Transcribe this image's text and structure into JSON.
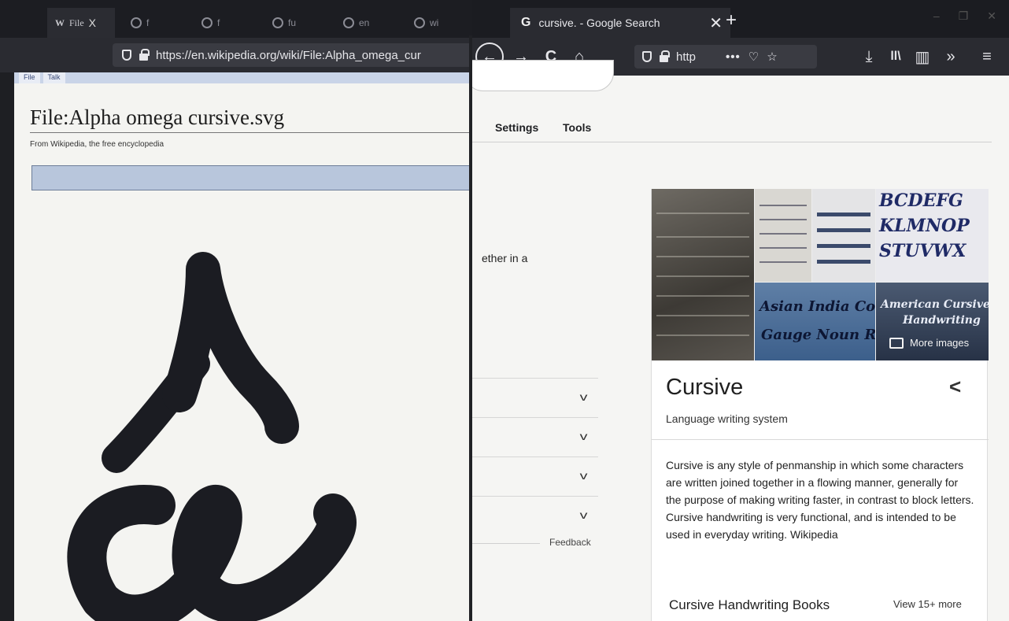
{
  "left_window": {
    "tabs": [
      {
        "favicon": "W",
        "label": "File",
        "close": "X"
      },
      {
        "favicon": "G",
        "label": "f"
      },
      {
        "favicon": "G",
        "label": "f"
      },
      {
        "favicon": "G",
        "label": "fu"
      },
      {
        "favicon": "G",
        "label": "en"
      },
      {
        "favicon": "G",
        "label": "wi"
      }
    ],
    "url": "https://en.wikipedia.org/wiki/File:Alpha_omega_cur",
    "wiki_tabs": [
      "File",
      "Talk"
    ],
    "title": "File:Alpha omega cursive.svg",
    "subtitle": "From Wikipedia, the free encyclopedia"
  },
  "right_window": {
    "tab_title": "cursive. - Google Search",
    "tab_favicon": "G",
    "tab_close": "✕",
    "new_tab": "+",
    "window_controls": [
      "–",
      "❐",
      "✕"
    ],
    "toolbar": {
      "back_icon": "←",
      "forward_icon": "→",
      "reload_icon": "C",
      "home_icon": "⌂",
      "url": "http",
      "url_more": "•••",
      "pocket_icon": "♡",
      "bookmark_icon": "☆",
      "download_icon": "⤓",
      "library_icon": "ll\\",
      "sidebar_icon": "▥",
      "overflow_icon": "»",
      "menu_icon": "≡"
    },
    "nav": {
      "settings": "Settings",
      "tools": "Tools"
    },
    "snippet": "ether in a",
    "paa_chevron": "v",
    "feedback": "Feedback",
    "knowledge_panel": {
      "title": "Cursive",
      "share_icon": "<",
      "subtitle": "Language writing system",
      "description": "Cursive is any style of penmanship in which some characters are written joined together in a flowing manner, generally for the purpose of making writing faster, in contrast to block letters. Cursive handwriting is very functional, and is intended to be used in everyday writing. Wikipedia",
      "more_images": "More images",
      "image_texts": {
        "alphabet_row1": "BCDEFG",
        "alphabet_row2": "KLMNOP",
        "alphabet_row3": "STUVWX",
        "blue_line1": "Asian India Coco",
        "blue_line2": "Gauge Noun R",
        "dark_line1": "American Cursive",
        "dark_line2": "Handwriting"
      },
      "books_heading": "Cursive Handwriting Books",
      "view_more": "View 15+ more"
    }
  }
}
